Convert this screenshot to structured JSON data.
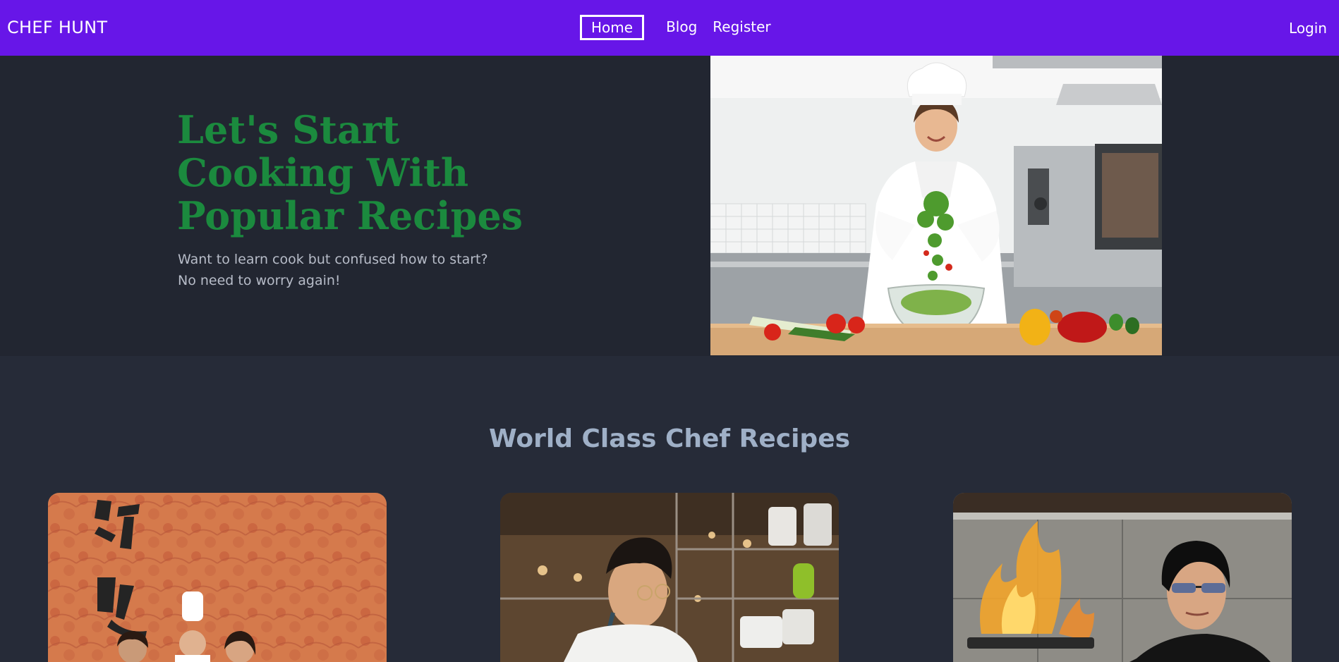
{
  "nav": {
    "brand": "CHEF HUNT",
    "links": [
      "Home",
      "Blog",
      "Register"
    ],
    "active": "Home",
    "login": "Login"
  },
  "hero": {
    "title": "Let's Start Cooking With Popular Recipes",
    "subtitle_line1": "Want to learn cook but confused how to start?",
    "subtitle_line2": "No need to worry again!",
    "image": "chef-tossing-salad-photo"
  },
  "section": {
    "title": "World Class Chef Recipes",
    "cards": [
      {
        "image": "chef-family-photo"
      },
      {
        "image": "chef-in-kitchen-photo"
      },
      {
        "image": "chef-with-flames-photo"
      }
    ]
  },
  "colors": {
    "navbar": "#6716e8",
    "hero_bg": "#222631",
    "page_bg": "#262b38",
    "hero_title": "#1b8a3e",
    "section_title": "#9fb0c7"
  }
}
